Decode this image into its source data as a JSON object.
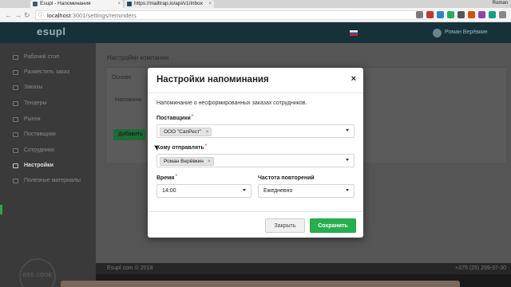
{
  "browser": {
    "tabs": [
      {
        "title": "Esupl - Напоминания",
        "favicon_color": "#3b5f6b"
      },
      {
        "title": "https://mailtrap.io/api/v1/inbox",
        "favicon_color": "#1d4f6b"
      }
    ],
    "profile_name": "Roman",
    "url_host": "localhost",
    "url_path": ":3001/settings/reminders"
  },
  "app": {
    "logo": "esupl",
    "sidebar": {
      "items": [
        {
          "label": "Рабочий стол",
          "active": false
        },
        {
          "label": "Разместить заказ",
          "active": false
        },
        {
          "label": "Заказы",
          "active": false
        },
        {
          "label": "Тендеры",
          "active": false
        },
        {
          "label": "Рынок",
          "active": false
        },
        {
          "label": "Поставщики",
          "active": false
        },
        {
          "label": "Сотрудники",
          "active": false
        },
        {
          "label": "Настройки",
          "active": true
        },
        {
          "label": "Полезные материалы",
          "active": false
        }
      ],
      "beer_logo": "BEE СВОЕ"
    },
    "content": {
      "title": "Настройки компании",
      "tab": "Основн",
      "row_label": "Напомина",
      "button": "Добавить"
    },
    "footer": {
      "copyright": "Esupl.com © 2018",
      "phone": "+375 (29) 299-97-30"
    }
  },
  "modal": {
    "title": "Настройки напоминания",
    "close_symbol": "×",
    "description": "Напоминание о несформированных заказах сотрудников.",
    "suppliers": {
      "label": "Поставщики",
      "required_mark": "*",
      "tags": [
        "ООО \"СапРест\""
      ],
      "tag_remove": "×"
    },
    "recipients": {
      "label": "Кому отправлять",
      "required_mark": "*",
      "tags": [
        "Роман Верёвкин"
      ],
      "tag_remove": "×"
    },
    "time": {
      "label": "Время",
      "required_mark": "*",
      "value": "14:00"
    },
    "frequency": {
      "label": "Частота повторений",
      "value": "Ежедневно"
    },
    "buttons": {
      "close": "Закрыть",
      "save": "Сохранить"
    }
  }
}
